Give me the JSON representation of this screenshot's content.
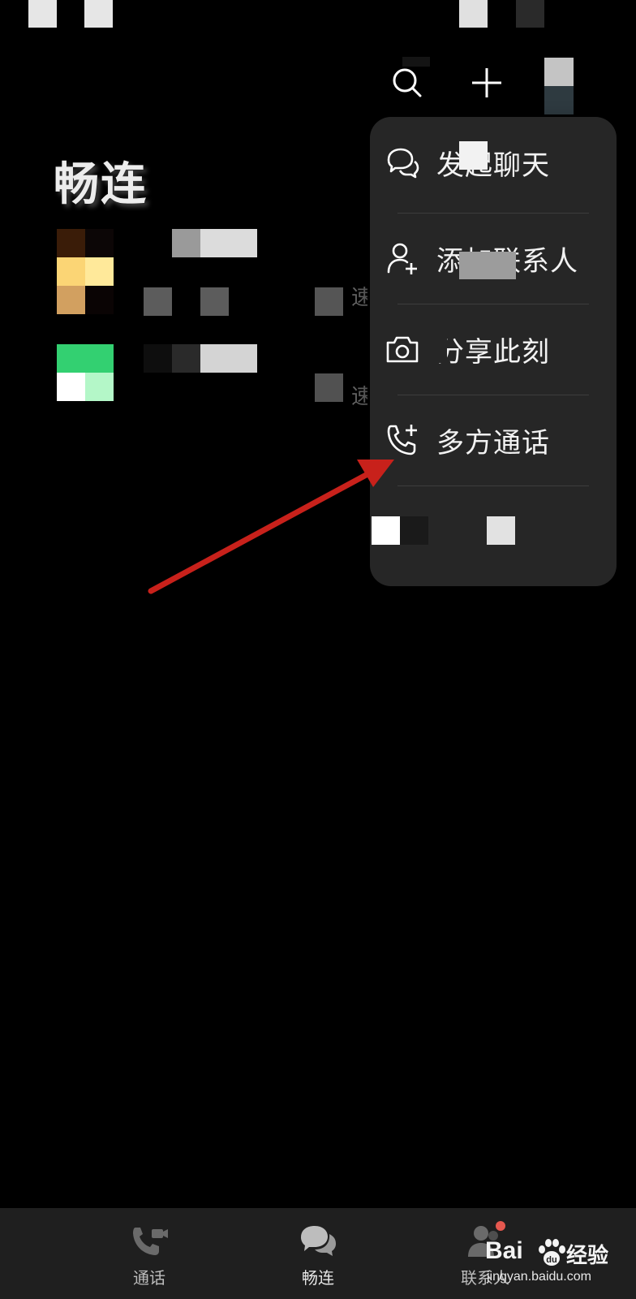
{
  "header": {
    "title": "畅连",
    "search_icon": "search-icon",
    "add_icon": "plus-icon"
  },
  "popup_menu": {
    "items": [
      {
        "label": "发起聊天",
        "icon": "chat-bubbles-icon"
      },
      {
        "label": "添加联系人",
        "icon": "add-contact-icon"
      },
      {
        "label": "分享此刻",
        "icon": "camera-icon"
      },
      {
        "label": "多方通话",
        "icon": "phone-add-icon"
      }
    ]
  },
  "chat_list": {
    "rows": [
      {
        "snippet": "速"
      },
      {
        "snippet": "速"
      }
    ]
  },
  "bottom_nav": {
    "tabs": [
      {
        "label": "通话",
        "icon": "video-call-icon"
      },
      {
        "label": "畅连",
        "icon": "chat-icon",
        "active": true
      },
      {
        "label": "联系人",
        "icon": "contacts-icon"
      }
    ]
  },
  "watermark": {
    "brand": "Bai",
    "brand_cn": "经验",
    "url": "jingyan.baidu.com"
  },
  "colors": {
    "background": "#000000",
    "popup": "#262626",
    "nav": "#1f1f1f",
    "annotation_arrow": "#c8211b",
    "badge": "#e5584f"
  }
}
